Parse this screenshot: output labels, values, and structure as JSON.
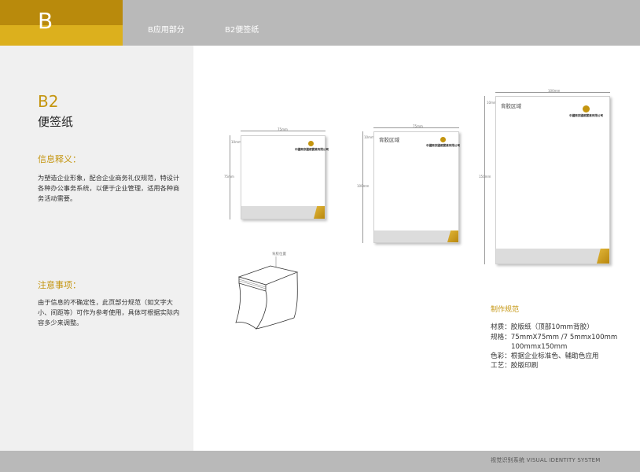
{
  "header": {
    "section_letter": "B",
    "nav": [
      "B应用部分",
      "B2便签纸"
    ]
  },
  "left_panel": {
    "code": "B2",
    "title": "便签纸",
    "info_heading": "信息释义：",
    "info_text": "为塑造企业形象，配合企业商务礼仪规范，特设计各种办公事务系统，以便于企业管理，适用各种商务活动需要。",
    "notice_heading": "注意事项：",
    "notice_text": "由于信息的不确定性，此页部分规范（如文字大小、间距等）可作为参考使用，具体可根据实际内容多少来调整。"
  },
  "pads": {
    "small": {
      "width_label": "75mm",
      "height_label": "75mm",
      "top_label": "10mm",
      "company": "中國南京國都實業有限公司"
    },
    "medium": {
      "width_label": "75mm",
      "height_label": "100mm",
      "top_label": "10mm",
      "glue_area": "背胶区域",
      "company": "中國南京國都實業有限公司"
    },
    "large": {
      "width_label": "100mm",
      "height_label": "150mm",
      "top_label": "10mm",
      "glue_area": "背胶区域",
      "company": "中國南京國都實業有限公司"
    },
    "sketch_label": "背胶位置"
  },
  "specs": {
    "heading": "制作规范",
    "rows": [
      "材质：胶版纸（顶部10mm背胶）",
      "规格：75mmX75mm /7 5mmx100mm",
      "      100mmx150mm",
      "色彩：根据企业标准色、辅助色应用",
      "工艺：胶版印刷"
    ]
  },
  "footer": {
    "text": "视觉识别系统   VISUAL IDENTITY SYSTEM"
  },
  "colors": {
    "gold": "#c4950f",
    "gold_light": "#dcb01d",
    "header_gray": "#b9b9b9",
    "panel_gray": "#f0f0f0"
  }
}
